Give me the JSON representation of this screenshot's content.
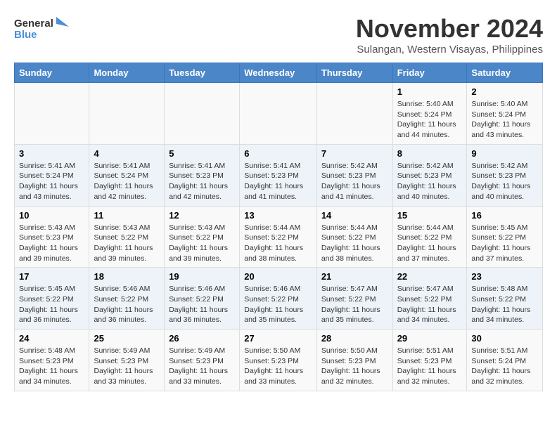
{
  "logo": {
    "line1": "General",
    "line2": "Blue"
  },
  "title": "November 2024",
  "location": "Sulangan, Western Visayas, Philippines",
  "weekdays": [
    "Sunday",
    "Monday",
    "Tuesday",
    "Wednesday",
    "Thursday",
    "Friday",
    "Saturday"
  ],
  "weeks": [
    [
      {
        "day": "",
        "info": ""
      },
      {
        "day": "",
        "info": ""
      },
      {
        "day": "",
        "info": ""
      },
      {
        "day": "",
        "info": ""
      },
      {
        "day": "",
        "info": ""
      },
      {
        "day": "1",
        "info": "Sunrise: 5:40 AM\nSunset: 5:24 PM\nDaylight: 11 hours and 44 minutes."
      },
      {
        "day": "2",
        "info": "Sunrise: 5:40 AM\nSunset: 5:24 PM\nDaylight: 11 hours and 43 minutes."
      }
    ],
    [
      {
        "day": "3",
        "info": "Sunrise: 5:41 AM\nSunset: 5:24 PM\nDaylight: 11 hours and 43 minutes."
      },
      {
        "day": "4",
        "info": "Sunrise: 5:41 AM\nSunset: 5:24 PM\nDaylight: 11 hours and 42 minutes."
      },
      {
        "day": "5",
        "info": "Sunrise: 5:41 AM\nSunset: 5:23 PM\nDaylight: 11 hours and 42 minutes."
      },
      {
        "day": "6",
        "info": "Sunrise: 5:41 AM\nSunset: 5:23 PM\nDaylight: 11 hours and 41 minutes."
      },
      {
        "day": "7",
        "info": "Sunrise: 5:42 AM\nSunset: 5:23 PM\nDaylight: 11 hours and 41 minutes."
      },
      {
        "day": "8",
        "info": "Sunrise: 5:42 AM\nSunset: 5:23 PM\nDaylight: 11 hours and 40 minutes."
      },
      {
        "day": "9",
        "info": "Sunrise: 5:42 AM\nSunset: 5:23 PM\nDaylight: 11 hours and 40 minutes."
      }
    ],
    [
      {
        "day": "10",
        "info": "Sunrise: 5:43 AM\nSunset: 5:23 PM\nDaylight: 11 hours and 39 minutes."
      },
      {
        "day": "11",
        "info": "Sunrise: 5:43 AM\nSunset: 5:22 PM\nDaylight: 11 hours and 39 minutes."
      },
      {
        "day": "12",
        "info": "Sunrise: 5:43 AM\nSunset: 5:22 PM\nDaylight: 11 hours and 39 minutes."
      },
      {
        "day": "13",
        "info": "Sunrise: 5:44 AM\nSunset: 5:22 PM\nDaylight: 11 hours and 38 minutes."
      },
      {
        "day": "14",
        "info": "Sunrise: 5:44 AM\nSunset: 5:22 PM\nDaylight: 11 hours and 38 minutes."
      },
      {
        "day": "15",
        "info": "Sunrise: 5:44 AM\nSunset: 5:22 PM\nDaylight: 11 hours and 37 minutes."
      },
      {
        "day": "16",
        "info": "Sunrise: 5:45 AM\nSunset: 5:22 PM\nDaylight: 11 hours and 37 minutes."
      }
    ],
    [
      {
        "day": "17",
        "info": "Sunrise: 5:45 AM\nSunset: 5:22 PM\nDaylight: 11 hours and 36 minutes."
      },
      {
        "day": "18",
        "info": "Sunrise: 5:46 AM\nSunset: 5:22 PM\nDaylight: 11 hours and 36 minutes."
      },
      {
        "day": "19",
        "info": "Sunrise: 5:46 AM\nSunset: 5:22 PM\nDaylight: 11 hours and 36 minutes."
      },
      {
        "day": "20",
        "info": "Sunrise: 5:46 AM\nSunset: 5:22 PM\nDaylight: 11 hours and 35 minutes."
      },
      {
        "day": "21",
        "info": "Sunrise: 5:47 AM\nSunset: 5:22 PM\nDaylight: 11 hours and 35 minutes."
      },
      {
        "day": "22",
        "info": "Sunrise: 5:47 AM\nSunset: 5:22 PM\nDaylight: 11 hours and 34 minutes."
      },
      {
        "day": "23",
        "info": "Sunrise: 5:48 AM\nSunset: 5:22 PM\nDaylight: 11 hours and 34 minutes."
      }
    ],
    [
      {
        "day": "24",
        "info": "Sunrise: 5:48 AM\nSunset: 5:23 PM\nDaylight: 11 hours and 34 minutes."
      },
      {
        "day": "25",
        "info": "Sunrise: 5:49 AM\nSunset: 5:23 PM\nDaylight: 11 hours and 33 minutes."
      },
      {
        "day": "26",
        "info": "Sunrise: 5:49 AM\nSunset: 5:23 PM\nDaylight: 11 hours and 33 minutes."
      },
      {
        "day": "27",
        "info": "Sunrise: 5:50 AM\nSunset: 5:23 PM\nDaylight: 11 hours and 33 minutes."
      },
      {
        "day": "28",
        "info": "Sunrise: 5:50 AM\nSunset: 5:23 PM\nDaylight: 11 hours and 32 minutes."
      },
      {
        "day": "29",
        "info": "Sunrise: 5:51 AM\nSunset: 5:23 PM\nDaylight: 11 hours and 32 minutes."
      },
      {
        "day": "30",
        "info": "Sunrise: 5:51 AM\nSunset: 5:24 PM\nDaylight: 11 hours and 32 minutes."
      }
    ]
  ]
}
